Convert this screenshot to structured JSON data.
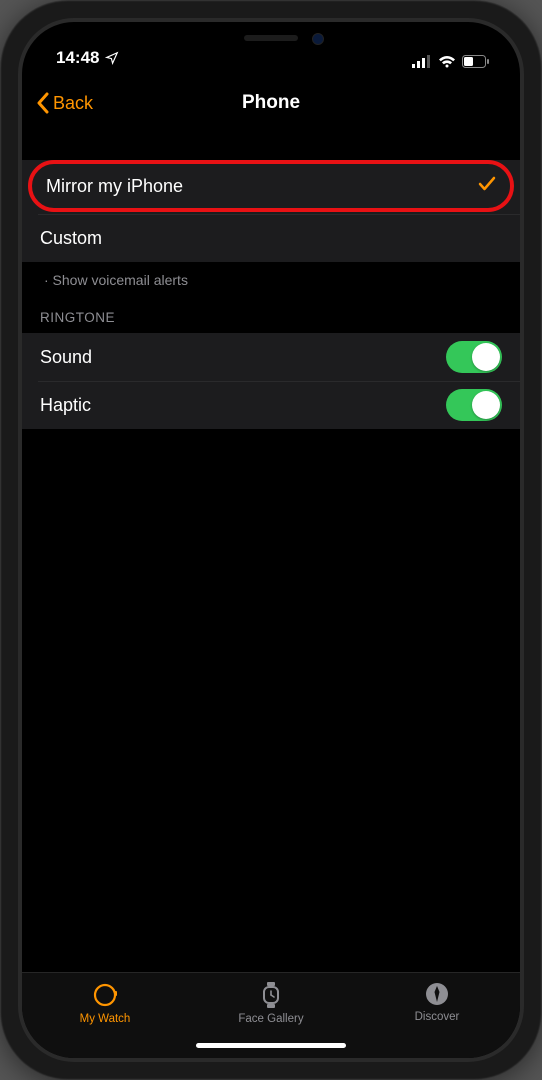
{
  "status": {
    "time": "14:48"
  },
  "nav": {
    "back": "Back",
    "title": "Phone"
  },
  "alerts": {
    "mirror": "Mirror my iPhone",
    "custom": "Custom",
    "note": "· Show voicemail alerts"
  },
  "ringtone": {
    "header": "RINGTONE",
    "sound": "Sound",
    "haptic": "Haptic"
  },
  "tabs": {
    "mywatch": "My Watch",
    "gallery": "Face Gallery",
    "discover": "Discover"
  }
}
